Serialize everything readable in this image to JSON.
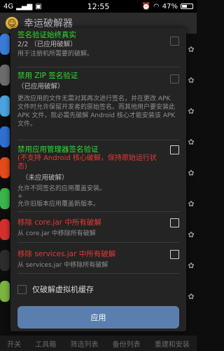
{
  "status_bar": {
    "signal": "4G",
    "clock": "12:55",
    "battery": "47%"
  },
  "app": {
    "title": "幸运破解器"
  },
  "bottom_tabs": [
    "开关",
    "工具箱",
    "筛选列表",
    "备份列表",
    "重建和安装"
  ],
  "dialog": {
    "options": [
      {
        "title": "签名验证始终真实",
        "title_color": "green",
        "status": "2/2 （已应用破解）",
        "description": "用于注册机所需要的破解。",
        "checked": false
      },
      {
        "title": "禁用 ZIP 签名验证",
        "title_color": "green",
        "status": "（已应用破解）",
        "description": "更改应用的文件无需对其再次进行签名，并在更改 APK 文件时允许保留开发者的原始签名。而其他用户要安装此 APK 文件，就必需先破解 Android 核心才能安装该 APK 文件。",
        "checked": false
      },
      {
        "title": "禁用应用管理器签名验证",
        "title_color": "green",
        "note": "(不支持 Android 核心破解，保持原始运行状态)",
        "status": "（未应用破解）",
        "description": "允许不同签名的应用覆盖安装。\n+\n允许旧版本应用覆盖新版本。",
        "checked": false
      },
      {
        "title": "移除 core.jar 中所有破解",
        "title_color": "red",
        "description": "从 core.jar 中移除所有破解",
        "checked": false
      },
      {
        "title": "移除 services.jar 中所有破解",
        "title_color": "red",
        "description": "从 services.jar 中移除所有破解",
        "checked": false
      }
    ],
    "vm_cache_label": "仅破解虚拟机缓存",
    "apply_label": "应用"
  }
}
